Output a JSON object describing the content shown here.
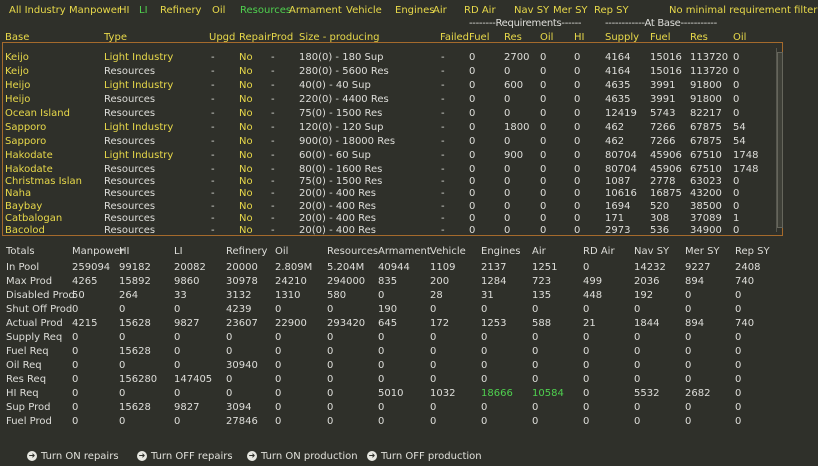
{
  "filters": [
    {
      "label": "All Industry",
      "active": false
    },
    {
      "label": "Manpower",
      "active": false
    },
    {
      "label": "HI",
      "active": false
    },
    {
      "label": "LI",
      "active": true
    },
    {
      "label": "Refinery",
      "active": false
    },
    {
      "label": "Oil",
      "active": false
    },
    {
      "label": "Resources",
      "active": true
    },
    {
      "label": "Armament",
      "active": false
    },
    {
      "label": "Vehicle",
      "active": false
    },
    {
      "label": "Engines",
      "active": false
    },
    {
      "label": "Air",
      "active": false
    },
    {
      "label": "RD Air",
      "active": false
    },
    {
      "label": "Nav SY",
      "active": false
    },
    {
      "label": "Mer SY",
      "active": false
    },
    {
      "label": "Rep SY",
      "active": false
    },
    {
      "label": "No minimal requirement filter",
      "active": false
    }
  ],
  "group_headers": {
    "requirements": "--------Requirements------",
    "at_base": "------------At Base-----------"
  },
  "columns": [
    "Base",
    "Type",
    "Upgd",
    "Repair",
    "Prod",
    "Size - producing",
    "Failed",
    "Fuel",
    "Res",
    "Oil",
    "HI",
    "Supply",
    "Fuel",
    "Res",
    "Oil"
  ],
  "bases": [
    {
      "base": "Keijo",
      "type": "Light Industry",
      "upgd": "-",
      "repair": "No",
      "prod": "-",
      "size": "180(0) - 180 Sup",
      "failed": "-",
      "fuel": "0",
      "res": "2700",
      "oil": "0",
      "hi": "0",
      "supply": "4164",
      "b_fuel": "15016",
      "b_res": "113720",
      "b_oil": "0"
    },
    {
      "base": "Keijo",
      "type": "Resources",
      "upgd": "-",
      "repair": "No",
      "prod": "-",
      "size": "280(0) - 5600 Res",
      "failed": "-",
      "fuel": "0",
      "res": "0",
      "oil": "0",
      "hi": "0",
      "supply": "4164",
      "b_fuel": "15016",
      "b_res": "113720",
      "b_oil": "0"
    },
    {
      "base": "Heijo",
      "type": "Light Industry",
      "upgd": "-",
      "repair": "No",
      "prod": "-",
      "size": "40(0) - 40 Sup",
      "failed": "-",
      "fuel": "0",
      "res": "600",
      "oil": "0",
      "hi": "0",
      "supply": "4635",
      "b_fuel": "3991",
      "b_res": "91800",
      "b_oil": "0"
    },
    {
      "base": "Heijo",
      "type": "Resources",
      "upgd": "-",
      "repair": "No",
      "prod": "-",
      "size": "220(0) - 4400 Res",
      "failed": "-",
      "fuel": "0",
      "res": "0",
      "oil": "0",
      "hi": "0",
      "supply": "4635",
      "b_fuel": "3991",
      "b_res": "91800",
      "b_oil": "0"
    },
    {
      "base": "Ocean Island",
      "type": "Resources",
      "upgd": "-",
      "repair": "No",
      "prod": "-",
      "size": "75(0) - 1500 Res",
      "failed": "-",
      "fuel": "0",
      "res": "0",
      "oil": "0",
      "hi": "0",
      "supply": "12419",
      "b_fuel": "5743",
      "b_res": "82217",
      "b_oil": "0"
    },
    {
      "base": "Sapporo",
      "type": "Light Industry",
      "upgd": "-",
      "repair": "No",
      "prod": "-",
      "size": "120(0) - 120 Sup",
      "failed": "-",
      "fuel": "0",
      "res": "1800",
      "oil": "0",
      "hi": "0",
      "supply": "462",
      "b_fuel": "7266",
      "b_res": "67875",
      "b_oil": "54"
    },
    {
      "base": "Sapporo",
      "type": "Resources",
      "upgd": "-",
      "repair": "No",
      "prod": "-",
      "size": "900(0) - 18000 Res",
      "failed": "-",
      "fuel": "0",
      "res": "0",
      "oil": "0",
      "hi": "0",
      "supply": "462",
      "b_fuel": "7266",
      "b_res": "67875",
      "b_oil": "54"
    },
    {
      "base": "Hakodate",
      "type": "Light Industry",
      "upgd": "-",
      "repair": "No",
      "prod": "-",
      "size": "60(0) - 60 Sup",
      "failed": "-",
      "fuel": "0",
      "res": "900",
      "oil": "0",
      "hi": "0",
      "supply": "80704",
      "b_fuel": "45906",
      "b_res": "67510",
      "b_oil": "1748"
    },
    {
      "base": "Hakodate",
      "type": "Resources",
      "upgd": "-",
      "repair": "No",
      "prod": "-",
      "size": "80(0) - 1600 Res",
      "failed": "-",
      "fuel": "0",
      "res": "0",
      "oil": "0",
      "hi": "0",
      "supply": "80704",
      "b_fuel": "45906",
      "b_res": "67510",
      "b_oil": "1748"
    },
    {
      "base": "Christmas Islan",
      "type": "Resources",
      "upgd": "-",
      "repair": "No",
      "prod": "-",
      "size": "75(0) - 1500 Res",
      "failed": "-",
      "fuel": "0",
      "res": "0",
      "oil": "0",
      "hi": "0",
      "supply": "1087",
      "b_fuel": "2778",
      "b_res": "63023",
      "b_oil": "0"
    },
    {
      "base": "Naha",
      "type": "Resources",
      "upgd": "-",
      "repair": "No",
      "prod": "-",
      "size": "20(0) - 400 Res",
      "failed": "-",
      "fuel": "0",
      "res": "0",
      "oil": "0",
      "hi": "0",
      "supply": "10616",
      "b_fuel": "16875",
      "b_res": "43200",
      "b_oil": "0"
    },
    {
      "base": "Baybay",
      "type": "Resources",
      "upgd": "-",
      "repair": "No",
      "prod": "-",
      "size": "20(0) - 400 Res",
      "failed": "-",
      "fuel": "0",
      "res": "0",
      "oil": "0",
      "hi": "0",
      "supply": "1694",
      "b_fuel": "520",
      "b_res": "38500",
      "b_oil": "0"
    },
    {
      "base": "Catbalogan",
      "type": "Resources",
      "upgd": "-",
      "repair": "No",
      "prod": "-",
      "size": "20(0) - 400 Res",
      "failed": "-",
      "fuel": "0",
      "res": "0",
      "oil": "0",
      "hi": "0",
      "supply": "171",
      "b_fuel": "308",
      "b_res": "37089",
      "b_oil": "1"
    },
    {
      "base": "Bacolod",
      "type": "Resources",
      "upgd": "-",
      "repair": "No",
      "prod": "-",
      "size": "20(0) - 400 Res",
      "failed": "-",
      "fuel": "0",
      "res": "0",
      "oil": "0",
      "hi": "0",
      "supply": "2973",
      "b_fuel": "536",
      "b_res": "34900",
      "b_oil": "0"
    }
  ],
  "totals_header": [
    "Totals",
    "Manpower",
    "HI",
    "LI",
    "Refinery",
    "Oil",
    "Resources",
    "Armament",
    "Vehicle",
    "Engines",
    "Air",
    "RD Air",
    "Nav SY",
    "Mer SY",
    "Rep SY"
  ],
  "totals": [
    {
      "label": "In Pool",
      "values": [
        "259094",
        "99182",
        "20082",
        "20000",
        "2.809M",
        "5.204M",
        "40944",
        "1109",
        "2137",
        "1251",
        "0",
        "14232",
        "9227",
        "2408"
      ]
    },
    {
      "label": "Max Prod",
      "values": [
        "4265",
        "15892",
        "9860",
        "30978",
        "24210",
        "294000",
        "835",
        "200",
        "1284",
        "723",
        "499",
        "2036",
        "894",
        "740"
      ]
    },
    {
      "label": "Disabled Prod",
      "values": [
        "50",
        "264",
        "33",
        "3132",
        "1310",
        "580",
        "0",
        "28",
        "31",
        "135",
        "448",
        "192",
        "0",
        "0"
      ]
    },
    {
      "label": "Shut Off Prod",
      "values": [
        "0",
        "0",
        "0",
        "4239",
        "0",
        "0",
        "190",
        "0",
        "0",
        "0",
        "0",
        "0",
        "0",
        "0"
      ]
    },
    {
      "label": "Actual Prod",
      "values": [
        "4215",
        "15628",
        "9827",
        "23607",
        "22900",
        "293420",
        "645",
        "172",
        "1253",
        "588",
        "21",
        "1844",
        "894",
        "740"
      ]
    },
    {
      "label": "Supply Req",
      "values": [
        "0",
        "0",
        "0",
        "0",
        "0",
        "0",
        "0",
        "0",
        "0",
        "0",
        "0",
        "0",
        "0",
        "0"
      ]
    },
    {
      "label": "Fuel Req",
      "values": [
        "0",
        "15628",
        "0",
        "0",
        "0",
        "0",
        "0",
        "0",
        "0",
        "0",
        "0",
        "0",
        "0",
        "0"
      ]
    },
    {
      "label": "Oil Req",
      "values": [
        "0",
        "0",
        "0",
        "30940",
        "0",
        "0",
        "0",
        "0",
        "0",
        "0",
        "0",
        "0",
        "0",
        "0"
      ]
    },
    {
      "label": "Res Req",
      "values": [
        "0",
        "156280",
        "147405",
        "0",
        "0",
        "0",
        "0",
        "0",
        "0",
        "0",
        "0",
        "0",
        "0",
        "0"
      ]
    },
    {
      "label": "HI Req",
      "values": [
        "0",
        "0",
        "0",
        "0",
        "0",
        "0",
        "5010",
        "1032",
        "18666",
        "10584",
        "0",
        "5532",
        "2682",
        "0"
      ]
    },
    {
      "label": "Sup Prod",
      "values": [
        "0",
        "15628",
        "9827",
        "3094",
        "0",
        "0",
        "0",
        "0",
        "0",
        "0",
        "0",
        "0",
        "0",
        "0"
      ]
    },
    {
      "label": "Fuel Prod",
      "values": [
        "0",
        "0",
        "0",
        "27846",
        "0",
        "0",
        "0",
        "0",
        "0",
        "0",
        "0",
        "0",
        "0",
        "0"
      ]
    }
  ],
  "highlight_color": "#4fd04f",
  "yellow_color": "#e8d94a",
  "buttons": [
    {
      "label": "Turn ON repairs",
      "icon": "arrow-right-icon"
    },
    {
      "label": "Turn OFF repairs",
      "icon": "arrow-right-icon"
    },
    {
      "label": "Turn ON production",
      "icon": "arrow-right-icon"
    },
    {
      "label": "Turn OFF production",
      "icon": "arrow-right-icon"
    }
  ]
}
